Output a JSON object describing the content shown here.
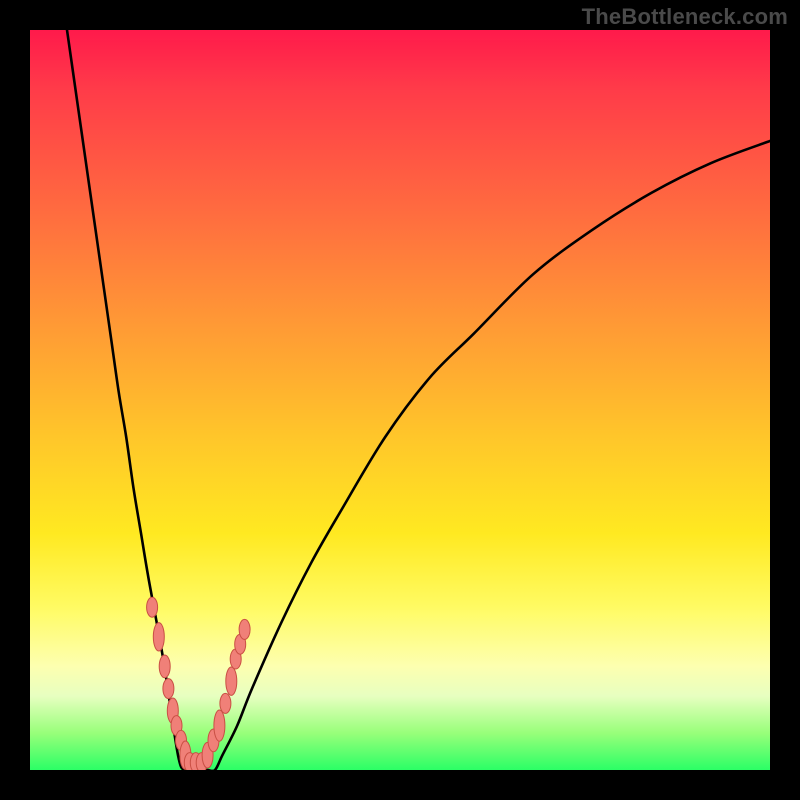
{
  "watermark": "TheBottleneck.com",
  "colors": {
    "frame": "#000000",
    "curve": "#000000",
    "marker_fill": "#f08078",
    "marker_stroke": "#c94f44",
    "gradient_top": "#ff1a4b",
    "gradient_bottom": "#2bff66"
  },
  "chart_data": {
    "type": "line",
    "title": "",
    "xlabel": "",
    "ylabel": "",
    "xlim": [
      0,
      100
    ],
    "ylim": [
      0,
      100
    ],
    "grid": false,
    "legend": false,
    "series": [
      {
        "name": "curve",
        "x": [
          5,
          6,
          7,
          8,
          9,
          10,
          11,
          12,
          13,
          14,
          15,
          16,
          18,
          20,
          21,
          22,
          23,
          24,
          25,
          26,
          28,
          30,
          34,
          38,
          42,
          48,
          54,
          60,
          68,
          76,
          84,
          92,
          100
        ],
        "y": [
          100,
          93,
          86,
          79,
          72,
          65,
          58,
          51,
          45,
          38,
          32,
          26,
          15,
          2,
          0,
          0,
          0,
          0,
          0,
          2,
          6,
          11,
          20,
          28,
          35,
          45,
          53,
          59,
          67,
          73,
          78,
          82,
          85
        ]
      }
    ],
    "markers": {
      "name": "data-points",
      "shape": "vertical-pill",
      "x": [
        16.5,
        17.4,
        18.2,
        18.7,
        19.3,
        19.8,
        20.4,
        21.0,
        21.6,
        22.4,
        23.2,
        24.0,
        24.8,
        25.6,
        26.4,
        27.2,
        27.8,
        28.4,
        29.0
      ],
      "y": [
        22,
        18,
        14,
        11,
        8,
        6,
        4,
        2,
        1,
        1,
        1,
        2,
        4,
        6,
        9,
        12,
        15,
        17,
        19
      ],
      "size": [
        1.0,
        1.6,
        1.2,
        1.0,
        1.4,
        1.0,
        1.0,
        1.6,
        1.0,
        1.0,
        1.0,
        1.4,
        1.2,
        1.8,
        1.0,
        1.6,
        1.0,
        1.0,
        1.0
      ]
    }
  }
}
